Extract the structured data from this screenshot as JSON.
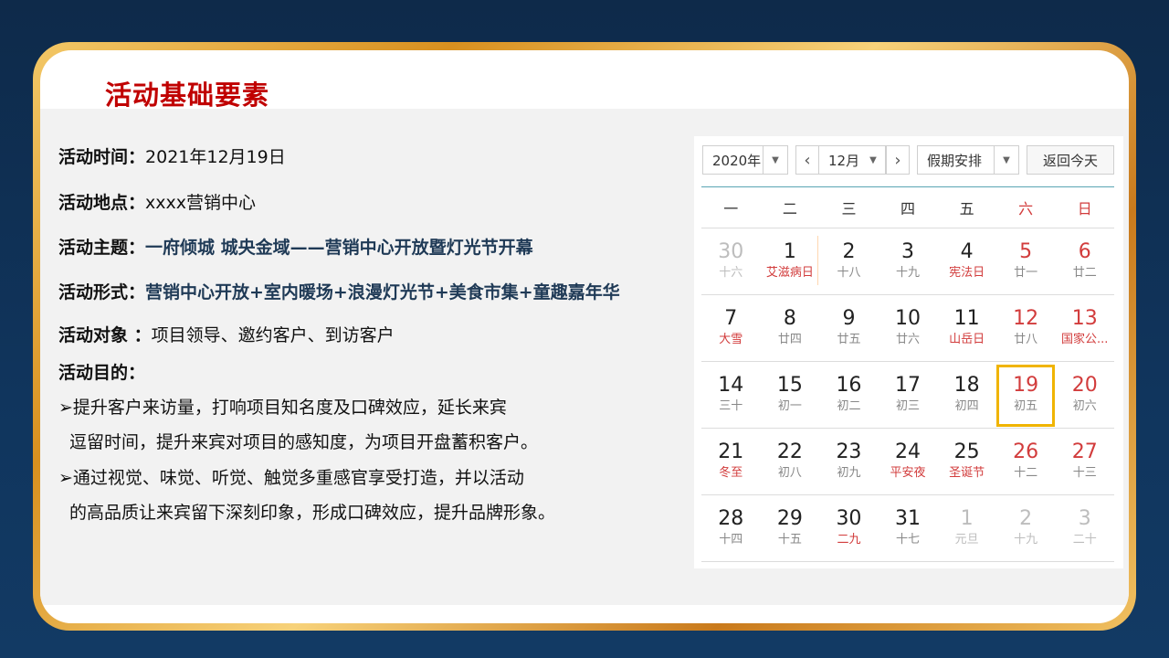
{
  "title": "活动基础要素",
  "details": {
    "time_label": "活动时间：",
    "time_value": "2021年12月19日",
    "place_label": "活动地点：",
    "place_value": "xxxx营销中心",
    "theme_label": "活动主题：",
    "theme_value": "一府倾城 城央金域——营销中心开放暨灯光节开幕",
    "form_label": "活动形式：",
    "form_value": "营销中心开放+室内暖场+浪漫灯光节+美食市集+童趣嘉年华",
    "target_label": "活动对象 ：",
    "target_value": "项目领导、邀约客户、到访客户",
    "purpose_label": "活动目的：",
    "purpose_1a": "➢提升客户来访量，打响项目知名度及口碑效应，延长来宾",
    "purpose_1b": "逗留时间，提升来宾对项目的感知度，为项目开盘蓄积客户。",
    "purpose_2a": "➢通过视觉、味觉、听觉、触觉多重感官享受打造，并以活动",
    "purpose_2b": "的高品质让来宾留下深刻印象，形成口碑效应，提升品牌形象。"
  },
  "calendar": {
    "year": "2020年",
    "month": "12月",
    "holiday_select": "假期安排",
    "today_button": "返回今天",
    "prev_icon": "chevron-left-icon",
    "next_icon": "chevron-right-icon",
    "accent_color": "#d23c3c",
    "today_border_color": "#f0b400",
    "weekdays": [
      "一",
      "二",
      "三",
      "四",
      "五",
      "六",
      "日"
    ],
    "weeks": [
      [
        [
          "30",
          "十六"
        ],
        [
          "1",
          "艾滋病日"
        ],
        [
          "2",
          "十八"
        ],
        [
          "3",
          "十九"
        ],
        [
          "4",
          "宪法日"
        ],
        [
          "5",
          "廿一"
        ],
        [
          "6",
          "廿二"
        ]
      ],
      [
        [
          "7",
          "大雪"
        ],
        [
          "8",
          "廿四"
        ],
        [
          "9",
          "廿五"
        ],
        [
          "10",
          "廿六"
        ],
        [
          "11",
          "山岳日"
        ],
        [
          "12",
          "廿八"
        ],
        [
          "13",
          "国家公..."
        ]
      ],
      [
        [
          "14",
          "三十"
        ],
        [
          "15",
          "初一"
        ],
        [
          "16",
          "初二"
        ],
        [
          "17",
          "初三"
        ],
        [
          "18",
          "初四"
        ],
        [
          "19",
          "初五"
        ],
        [
          "20",
          "初六"
        ]
      ],
      [
        [
          "21",
          "冬至"
        ],
        [
          "22",
          "初八"
        ],
        [
          "23",
          "初九"
        ],
        [
          "24",
          "平安夜"
        ],
        [
          "25",
          "圣诞节"
        ],
        [
          "26",
          "十二"
        ],
        [
          "27",
          "十三"
        ]
      ],
      [
        [
          "28",
          "十四"
        ],
        [
          "29",
          "十五"
        ],
        [
          "30",
          "二九"
        ],
        [
          "31",
          "十七"
        ],
        [
          "1",
          "元旦"
        ],
        [
          "2",
          "十九"
        ],
        [
          "3",
          "二十"
        ]
      ]
    ]
  }
}
